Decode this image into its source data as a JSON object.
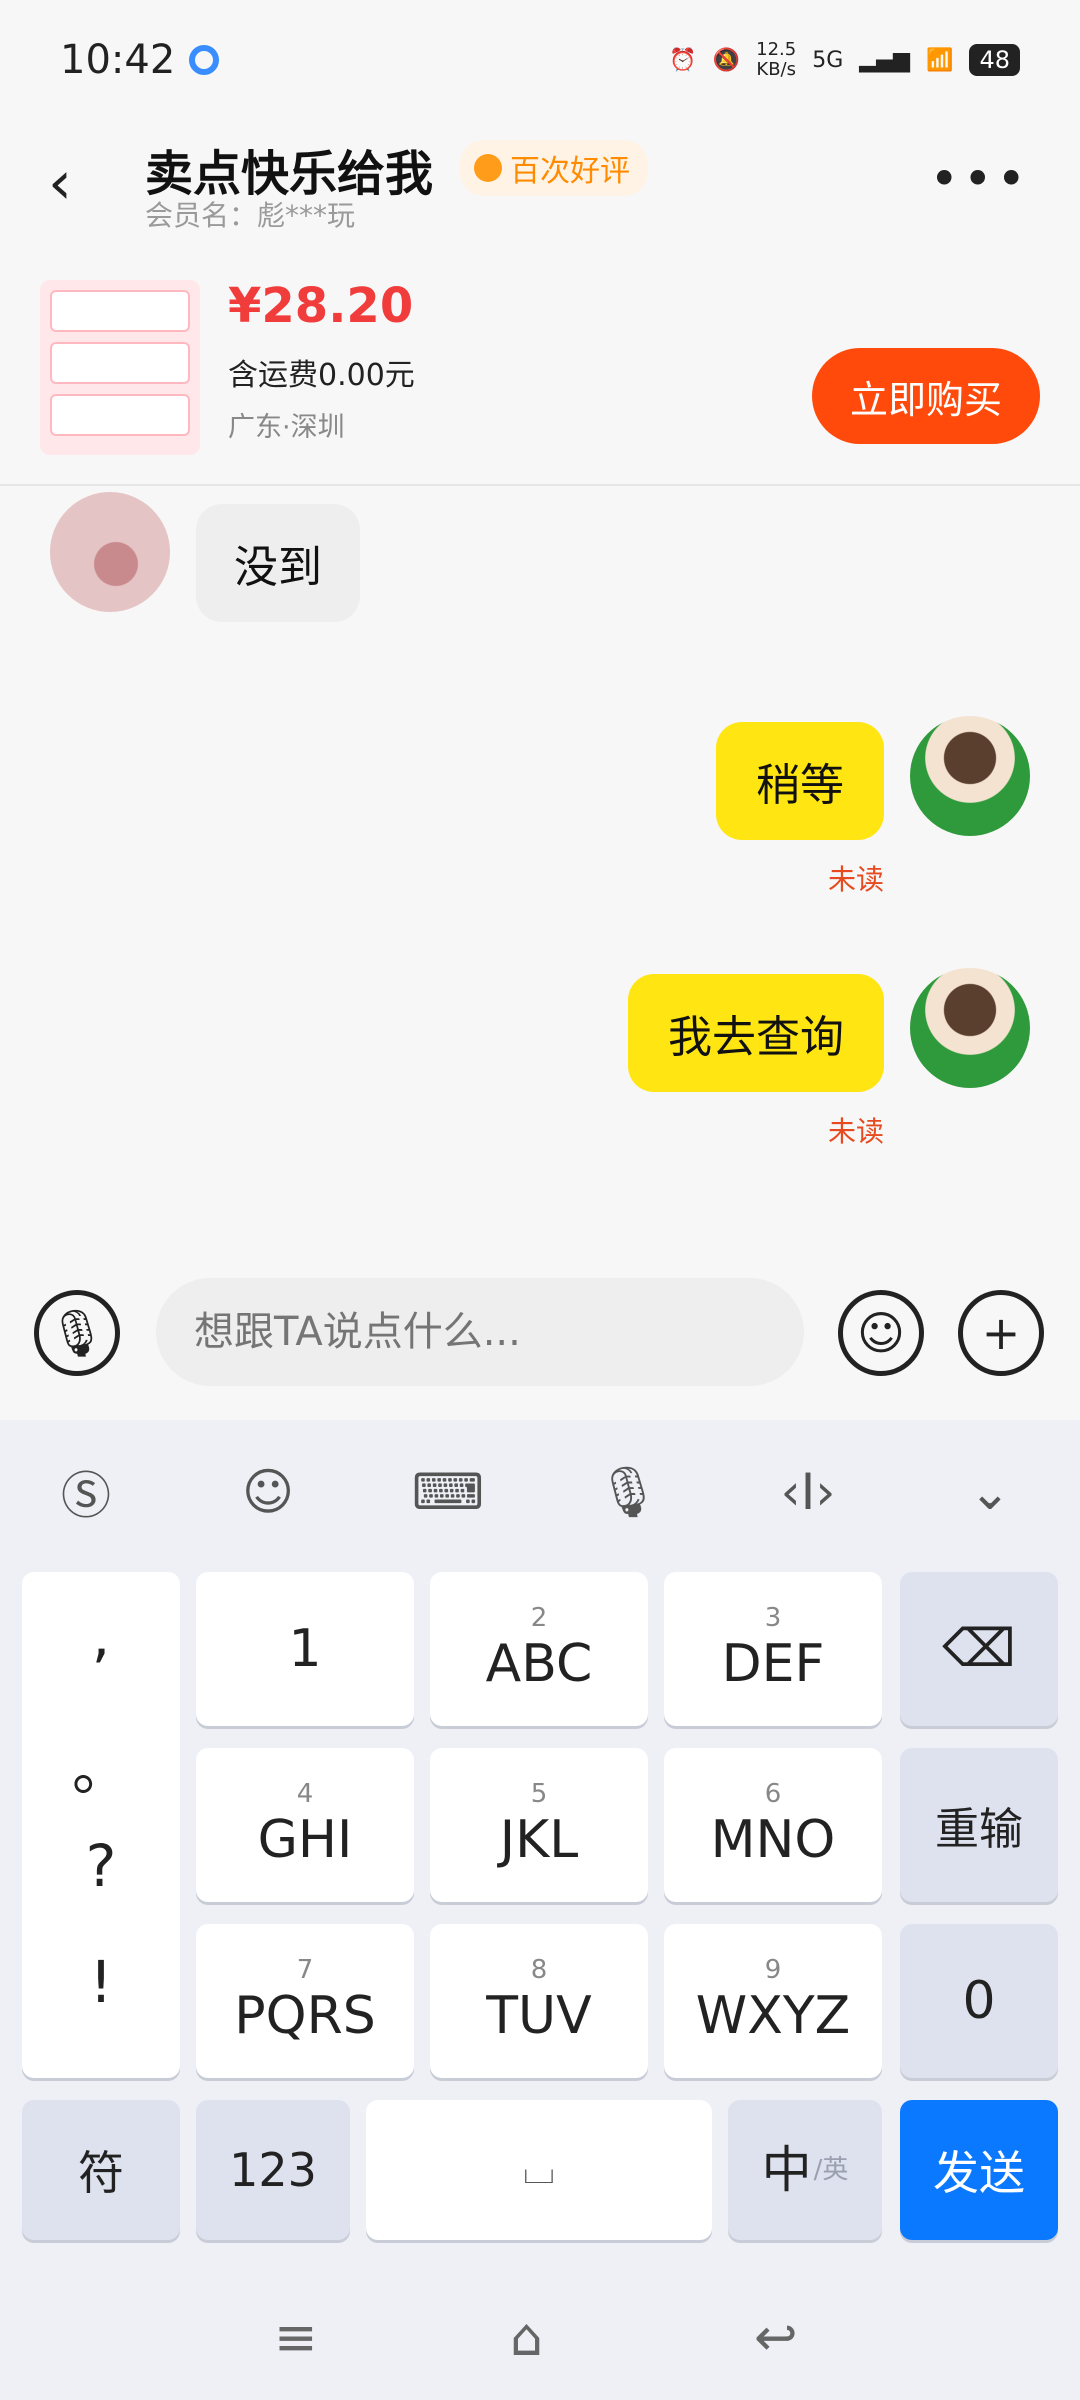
{
  "status_bar": {
    "time": "10:42",
    "net_speed": "12.5",
    "net_unit": "KB/s",
    "signal_label": "5G",
    "battery": "48"
  },
  "header": {
    "back_icon": "chevron-left",
    "title": "卖点快乐给我",
    "badge": "百次好评",
    "member_label": "会员名：彪***玩",
    "more_icon": "ellipsis"
  },
  "product": {
    "price": "¥28.20",
    "shipping": "含运费0.00元",
    "region": "广东·深圳",
    "buy_label": "立即购买"
  },
  "messages": [
    {
      "side": "left",
      "text": "没到"
    },
    {
      "side": "right",
      "text": "稍等",
      "status": "未读"
    },
    {
      "side": "right",
      "text": "我去查询",
      "status": "未读"
    }
  ],
  "input": {
    "placeholder": "想跟TA说点什么..."
  },
  "keyboard": {
    "punct": [
      ",",
      "。",
      "?",
      "!"
    ],
    "keys": [
      {
        "sub": "",
        "main": "1"
      },
      {
        "sub": "2",
        "main": "ABC"
      },
      {
        "sub": "3",
        "main": "DEF"
      },
      {
        "sub": "4",
        "main": "GHI"
      },
      {
        "sub": "5",
        "main": "JKL"
      },
      {
        "sub": "6",
        "main": "MNO"
      },
      {
        "sub": "7",
        "main": "PQRS"
      },
      {
        "sub": "8",
        "main": "TUV"
      },
      {
        "sub": "9",
        "main": "WXYZ"
      }
    ],
    "reinput": "重输",
    "zero": "0",
    "symbols": "符",
    "num123": "123",
    "lang_main": "中",
    "lang_sub": "/英",
    "send": "发送"
  },
  "colors": {
    "accent_orange": "#ff4a0b",
    "price_red": "#f13c3c",
    "bubble_yellow": "#ffe511",
    "send_blue": "#0a78ff"
  }
}
